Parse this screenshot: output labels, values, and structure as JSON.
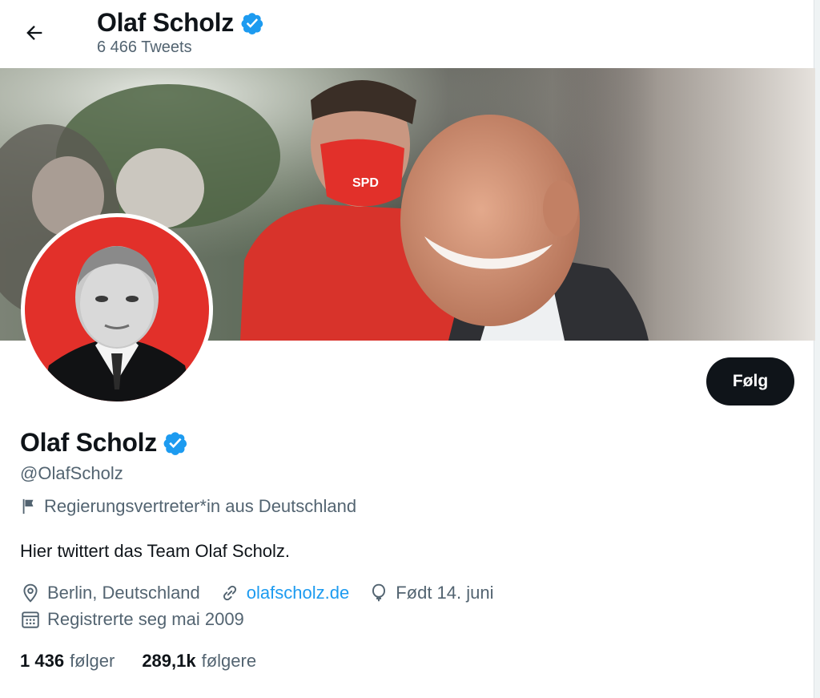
{
  "header": {
    "name": "Olaf Scholz",
    "tweet_count": "6 466 Tweets"
  },
  "profile": {
    "display_name": "Olaf Scholz",
    "handle": "@OlafScholz",
    "label": "Regierungsvertreter*in aus Deutschland",
    "bio": "Hier twittert das Team Olaf Scholz.",
    "location": "Berlin, Deutschland",
    "website": "olafscholz.de",
    "birthday": "Født 14. juni",
    "joined": "Registrerte seg mai 2009"
  },
  "actions": {
    "follow_label": "Følg"
  },
  "stats": {
    "following_count": "1 436",
    "following_label": "følger",
    "followers_count": "289,1k",
    "followers_label": "følgere"
  },
  "colors": {
    "verified": "#1d9bf0",
    "link": "#1d9bf0",
    "secondary_text": "#536471",
    "avatar_background": "#e2302a",
    "hoodie": "#d8332b"
  },
  "icons": [
    "back-arrow-icon",
    "verified-badge-icon",
    "flag-icon",
    "location-icon",
    "link-icon",
    "balloon-icon",
    "calendar-icon"
  ]
}
